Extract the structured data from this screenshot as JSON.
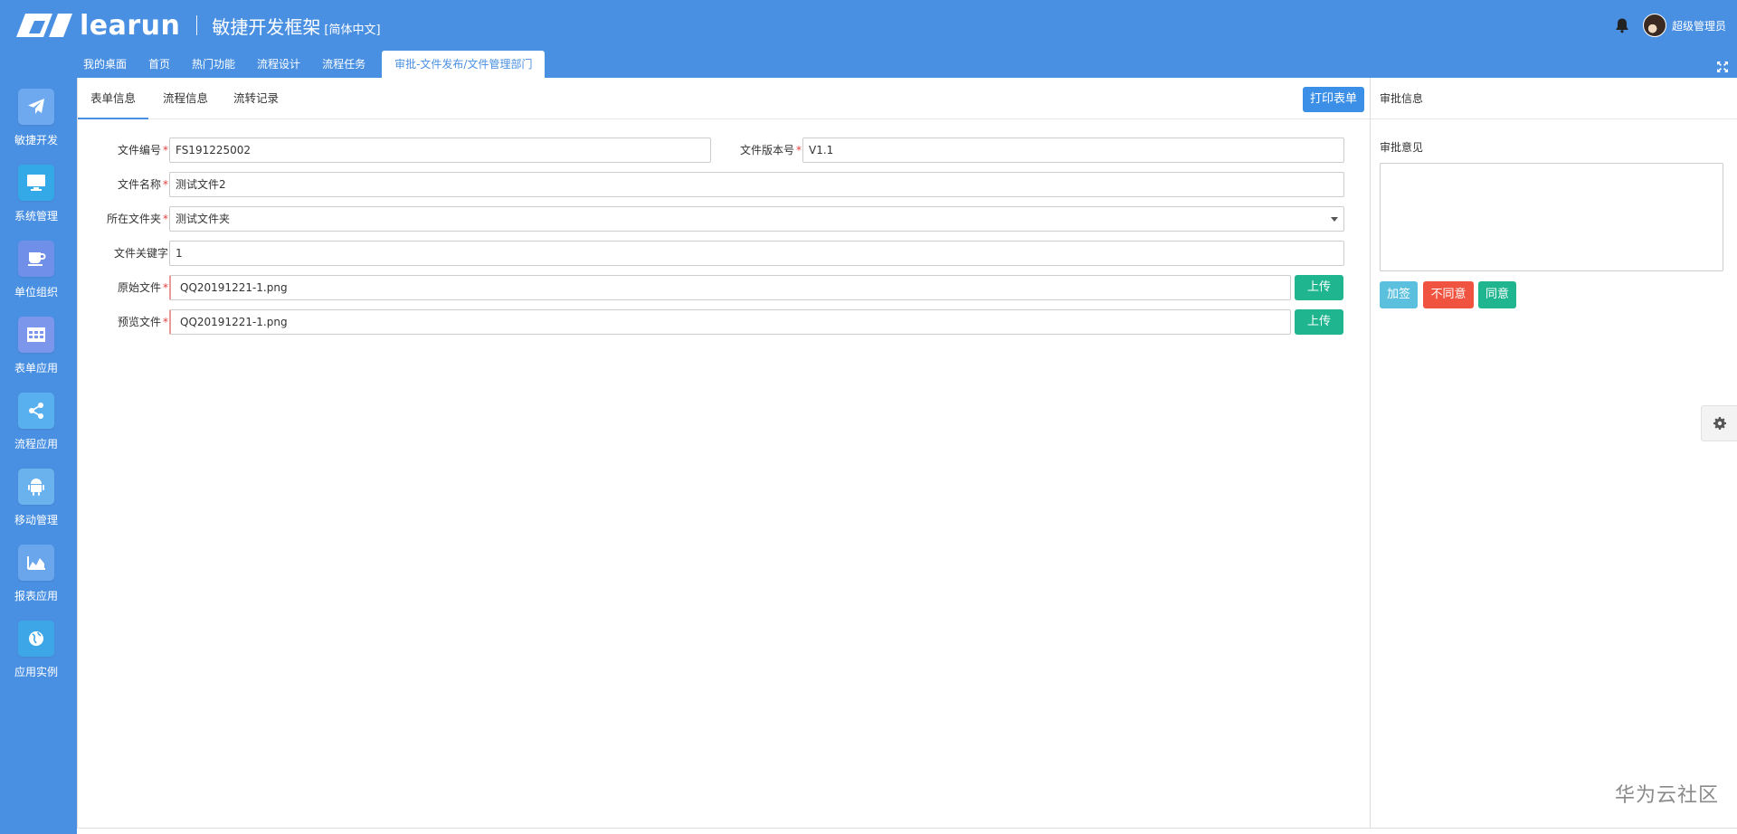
{
  "header": {
    "brand": "learun",
    "subtitle": "敏捷开发框架",
    "language": "[简体中文]",
    "username": "超级管理员"
  },
  "nav_tabs": [
    {
      "label": "我的桌面"
    },
    {
      "label": "首页"
    },
    {
      "label": "热门功能"
    },
    {
      "label": "流程设计"
    },
    {
      "label": "流程任务"
    },
    {
      "label": "审批-文件发布/文件管理部门"
    }
  ],
  "sidebar": {
    "items": [
      {
        "label": "敏捷开发",
        "icon": "paper-plane-icon"
      },
      {
        "label": "系统管理",
        "icon": "monitor-icon"
      },
      {
        "label": "单位组织",
        "icon": "coffee-cup-icon"
      },
      {
        "label": "表单应用",
        "icon": "table-icon"
      },
      {
        "label": "流程应用",
        "icon": "share-icon"
      },
      {
        "label": "移动管理",
        "icon": "android-icon"
      },
      {
        "label": "报表应用",
        "icon": "area-chart-icon"
      },
      {
        "label": "应用实例",
        "icon": "globe-icon"
      }
    ]
  },
  "form": {
    "tabs": [
      "表单信息",
      "流程信息",
      "流转记录"
    ],
    "print_label": "打印表单",
    "fields": {
      "file_no": {
        "label": "文件编号",
        "value": "FS191225002"
      },
      "version": {
        "label": "文件版本号",
        "value": "V1.1"
      },
      "file_name": {
        "label": "文件名称",
        "value": "测试文件2"
      },
      "folder": {
        "label": "所在文件夹",
        "value": "测试文件夹"
      },
      "keyword": {
        "label": "文件关键字",
        "value": "1"
      },
      "original": {
        "label": "原始文件",
        "value": "QQ20191221-1.png"
      },
      "preview": {
        "label": "预览文件",
        "value": "QQ20191221-1.png"
      }
    },
    "required_mark": "*",
    "upload_label": "上传"
  },
  "approval": {
    "title": "审批信息",
    "opinion_label": "审批意见",
    "buttons": {
      "sign": "加签",
      "disagree": "不同意",
      "agree": "同意"
    }
  },
  "colors": {
    "primary": "#4a90e2",
    "upload": "#1fb58f",
    "sign": "#5bc0de",
    "disagree": "#f0533f",
    "agree": "#1fb58f"
  },
  "watermark": "华为云社区"
}
